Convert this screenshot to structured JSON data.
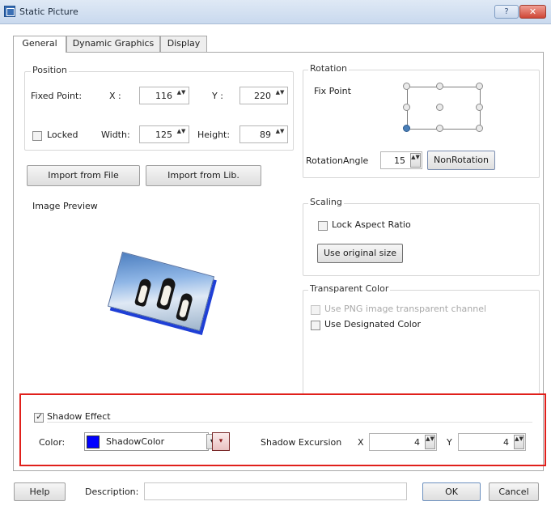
{
  "window": {
    "title": "Static Picture",
    "help_glyph": "?",
    "close_glyph": "✕"
  },
  "tabs": [
    {
      "label": "General",
      "active": true
    },
    {
      "label": "Dynamic Graphics",
      "active": false
    },
    {
      "label": "Display",
      "active": false
    }
  ],
  "position": {
    "group_label": "Position",
    "fixed_point_label": "Fixed Point:",
    "x_label": "X :",
    "x_value": "116",
    "y_label": "Y :",
    "y_value": "220",
    "locked_label": "Locked",
    "locked_checked": false,
    "width_label": "Width:",
    "width_value": "125",
    "height_label": "Height:",
    "height_value": "89"
  },
  "import": {
    "from_file": "Import from File",
    "from_lib": "Import from Lib."
  },
  "rotation": {
    "group_label": "Rotation",
    "fix_point_label": "Fix Point",
    "angle_label": "RotationAngle",
    "angle_value": "15",
    "non_rotation": "NonRotation"
  },
  "preview": {
    "label": "Image Preview"
  },
  "scaling": {
    "group_label": "Scaling",
    "lock_aspect_label": "Lock Aspect Ratio",
    "lock_aspect_checked": false,
    "use_original": "Use original size"
  },
  "transparent": {
    "group_label": "Transparent Color",
    "png_channel_label": "Use PNG image transparent channel",
    "png_channel_checked": false,
    "png_channel_disabled": true,
    "designated_label": "Use Designated Color",
    "designated_checked": false
  },
  "shadow": {
    "effect_label": "Shadow Effect",
    "effect_checked": true,
    "color_label": "Color:",
    "color_name": "ShadowColor",
    "color_hex": "#0000ff",
    "excursion_label": "Shadow Excursion",
    "x_label": "X",
    "x_value": "4",
    "y_label": "Y",
    "y_value": "4"
  },
  "footer": {
    "help": "Help",
    "description_label": "Description:",
    "description_value": "",
    "ok": "OK",
    "cancel": "Cancel"
  },
  "spin_glyph": "▲▼",
  "dropdown_glyph": "▼",
  "color_picker_glyph": "▾"
}
